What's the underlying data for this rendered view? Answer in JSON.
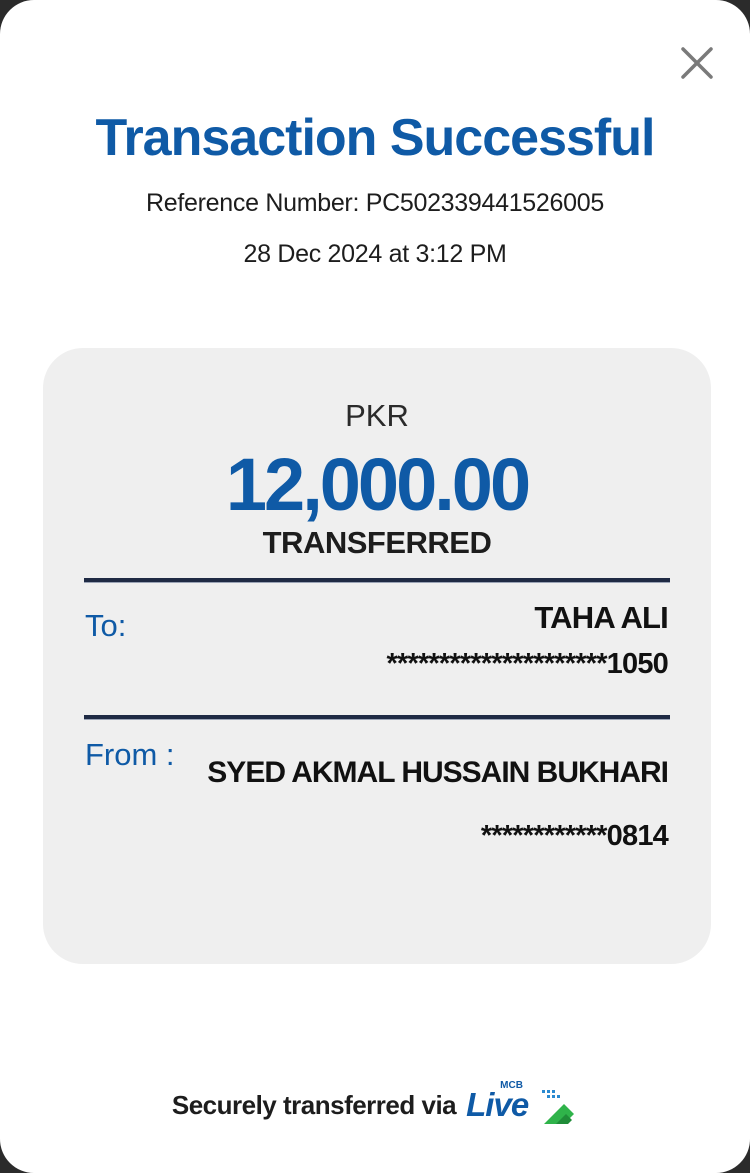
{
  "header": {
    "title": "Transaction Successful",
    "reference": "Reference Number: PC502339441526005",
    "datetime": "28 Dec 2024 at 3:12 PM"
  },
  "summary": {
    "currency": "PKR",
    "amount": "12,000.00",
    "status": "TRANSFERRED"
  },
  "to": {
    "label": "To:",
    "name": "TAHA ALI",
    "account": "*********************1050"
  },
  "from": {
    "label": "From :",
    "name": "SYED AKMAL HUSSAIN BUKHARI",
    "account": "************0814"
  },
  "footer": {
    "text": "Securely transferred via",
    "brand_word": "Live",
    "brand_small": "MCB"
  },
  "icons": {
    "close": "close-icon",
    "brand_arrow": "arrow-logo-icon"
  },
  "colors": {
    "accent": "#0f5aa6",
    "brand_green": "#2fb34a",
    "card_bg": "#efefef"
  }
}
